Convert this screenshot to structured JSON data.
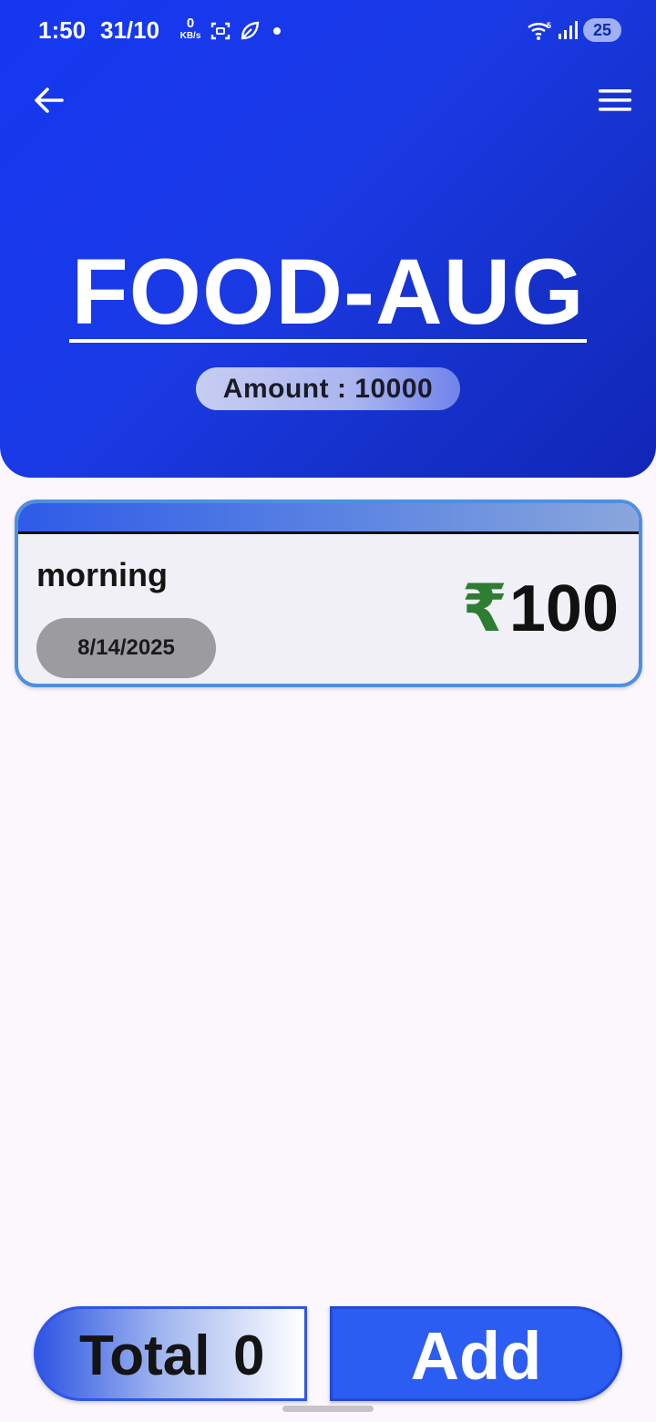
{
  "status_bar": {
    "time": "1:50",
    "date": "31/10",
    "net_speed_value": "0",
    "net_speed_unit": "KB/s",
    "battery": "25",
    "icons": [
      "screenshot-icon",
      "leaf-icon",
      "dot-icon",
      "wifi-icon",
      "signal-icon"
    ]
  },
  "header": {
    "title": "FOOD-AUG",
    "amount_label": "Amount : 10000",
    "gradient_colors": [
      "#1537f0",
      "#1226b8"
    ]
  },
  "entries": [
    {
      "name": "morning",
      "date": "8/14/2025",
      "currency_symbol": "₹",
      "amount": "100"
    }
  ],
  "footer": {
    "total_label": "Total",
    "total_value": "0",
    "add_label": "Add"
  },
  "colors": {
    "accent": "#2c5df3",
    "rupee": "#2e7d32",
    "card_border": "#4f8fe0",
    "page_bg": "#fbf7fc"
  }
}
